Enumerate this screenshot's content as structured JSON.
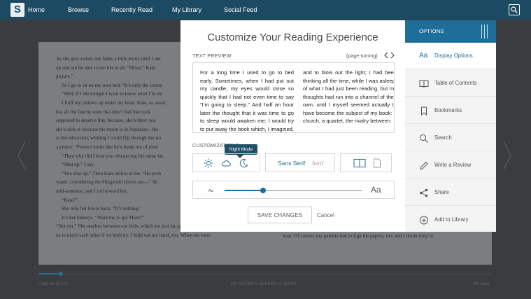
{
  "nav": {
    "logo": "S",
    "items": [
      "Home",
      "Browse",
      "Recently Read",
      "My Library",
      "Social Feed"
    ]
  },
  "reader": {
    "left_lines": [
      "As she gets sicker, she fades a little more, until I am",
      "up and not be able to see her at all. “Move,” Kate",
      "picture.”",
      "So I go to sit on my own bed. “It’s only the comm",
      "“Well, if I die tonight I want to know what I’m mi",
      "I fluff my pillows up under my head. Kate, as usual,",
      "has all the funchy ones that don’t feel like rock",
      "supposed to deserve this, because, she’s three yea",
      "she’s sick or because the moon is in Aquarius—the",
      "at the television, wishing I could flip through the sta",
      "a prayer. “Preston looks like he’s made out of plast",
      "“Then why did I hear you whispering his name las",
      "“Shut up,” I say.",
      "“You shut up.” Then Kate smiles at me. “He prob",
      "waste, considering the Fitzgerald sisters are—” Sh",
      "mid-sentence, and I roll toward her.",
      "“Kate?”",
      "She rubs her lower back. “It’s nothing.”",
      "It’s her kidneys. “Want me to get Mom?”",
      "“Not yet.” She reaches between our beds, which are just far apart enough for",
      "us to touch each other if we both try. I hold out my hand, too. When we were"
    ],
    "right_line": "loan. Of course, my parents had to sign the papers, too, and I doubt they’re",
    "footer": {
      "page": "Page 21 of 475",
      "book": "MY SISTER'S KEEPER: A NOVEL",
      "read": "4% read"
    },
    "progress_fraction": 0.05
  },
  "modal": {
    "title": "Customize Your Reading Experience",
    "preview_label": "TEXT PREVIEW",
    "page_turning": "(page turning)",
    "preview_col1": "For a long time I used to go to bed early. Sometimes, when I had put out my candle, my eyes would close so quickly that I had not even time to say “I’m going to sleep.” And half an hour later the thought that it was time to go to sleep would awaken me; I would try to put away the book which, I imagined, was still in my hands, and",
    "preview_col2": "and to blow out the light; I had been thinking all the time, while I was asleep, of what I had just been reading, but my thoughts had run into a channel of their own, until I myself seemed actually to have become the subject of my book: a church, a quartet, the rivalry between",
    "customizations_label": "CUSTOMIZATIONS",
    "tooltip": "Night Mode",
    "themes": [
      "sun-icon",
      "cloud-icon",
      "moon-icon"
    ],
    "fonts": [
      "Sans Serif",
      "Serif"
    ],
    "size_small": "Aa",
    "size_large": "Aa",
    "font_size_fraction": 0.28,
    "save_label": "SAVE CHANGES",
    "cancel_label": "Cancel"
  },
  "options": {
    "title": "OPTIONS",
    "items": [
      {
        "icon": "aa-icon",
        "label": "Display Options",
        "active": true
      },
      {
        "icon": "book-icon",
        "label": "Table of Contents",
        "active": false
      },
      {
        "icon": "bookmark-icon",
        "label": "Bookmarks",
        "active": false
      },
      {
        "icon": "search-icon",
        "label": "Search",
        "active": false
      },
      {
        "icon": "pencil-icon",
        "label": "Write a Review",
        "active": false
      },
      {
        "icon": "share-icon",
        "label": "Share",
        "active": false
      },
      {
        "icon": "plus-icon",
        "label": "Add to Library",
        "active": false
      }
    ]
  },
  "colors": {
    "nav_bg": "#1d4a63",
    "accent": "#1f6e9a",
    "tooltip_bg": "#1f5068"
  }
}
